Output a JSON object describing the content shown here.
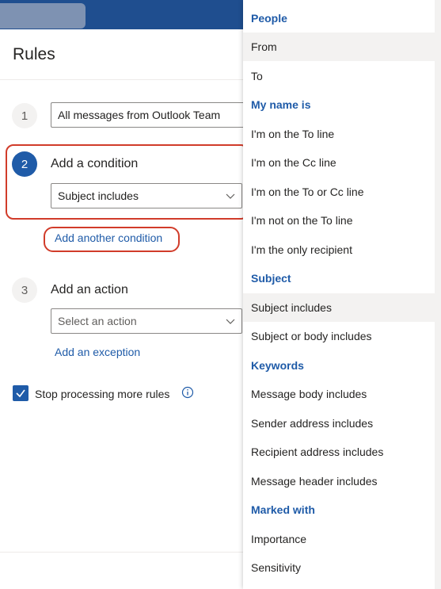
{
  "page": {
    "title": "Rules"
  },
  "rule_name": {
    "step": "1",
    "value": "All messages from Outlook Team"
  },
  "condition": {
    "step": "2",
    "label": "Add a condition",
    "selected": "Subject includes",
    "add_link": "Add another condition"
  },
  "action": {
    "step": "3",
    "label": "Add an action",
    "placeholder": "Select an action",
    "exception_link": "Add an exception"
  },
  "stop_processing": {
    "label": "Stop processing more rules",
    "checked": true
  },
  "menu": {
    "headers": [
      "People",
      "My name is",
      "Subject",
      "Keywords",
      "Marked with"
    ],
    "people": [
      "From",
      "To"
    ],
    "my_name_is": [
      "I'm on the To line",
      "I'm on the Cc line",
      "I'm on the To or Cc line",
      "I'm not on the To line",
      "I'm the only recipient"
    ],
    "subject": [
      "Subject includes",
      "Subject or body includes"
    ],
    "keywords": [
      "Message body includes",
      "Sender address includes",
      "Recipient address includes",
      "Message header includes"
    ],
    "marked_with": [
      "Importance",
      "Sensitivity"
    ]
  },
  "colors": {
    "accent": "#1f5ba8",
    "highlight_box": "#d13c2a",
    "topbar": "#1f4e8f"
  },
  "icons": [
    "chevron-down-icon",
    "checkmark-icon",
    "info-icon"
  ]
}
